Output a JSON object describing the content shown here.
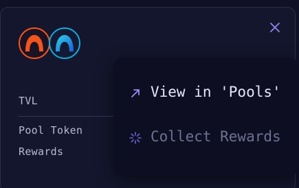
{
  "pool_card": {
    "close_icon": "close-icon",
    "token_logos": [
      "orange-token-logo",
      "teal-token-logo"
    ],
    "stats": {
      "tvl_label": "TVL",
      "pool_token_label": "Pool Token",
      "rewards_label": "Rewards"
    }
  },
  "menu": {
    "items": [
      {
        "label": "View in 'Pools'",
        "icon": "arrow-up-right-icon",
        "state": "enabled"
      },
      {
        "label": "Collect Rewards",
        "icon": "loading-spinner-icon",
        "state": "disabled"
      }
    ]
  },
  "colors": {
    "background": "#101126",
    "card": "#14162d",
    "menu": "#0d0e22",
    "accent": "#8b7cf6",
    "orange_token": "#f2551d",
    "teal_token": "#16a9d6"
  }
}
